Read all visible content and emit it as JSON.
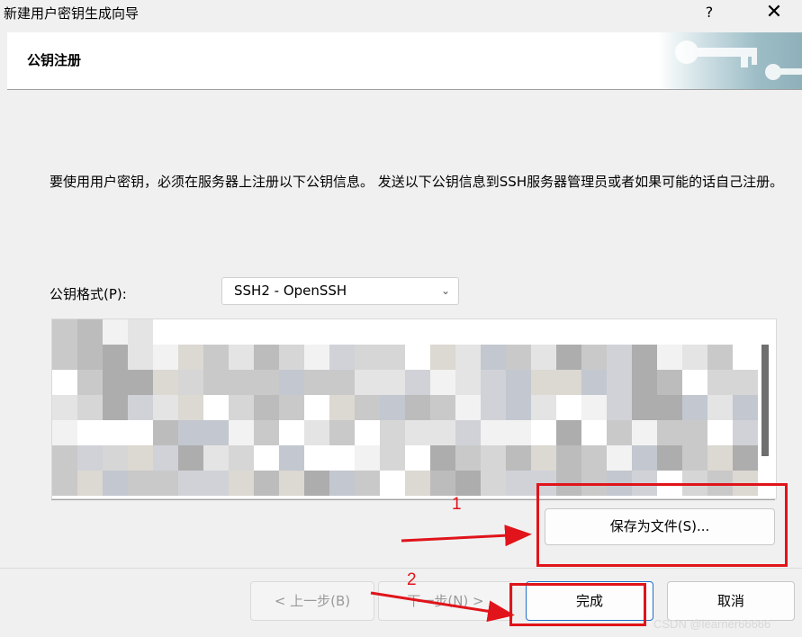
{
  "window": {
    "title": "新建用户密钥生成向导",
    "help_label": "?",
    "close_label": "✕"
  },
  "header": {
    "title": "公钥注册",
    "banner_icon": "key-icon"
  },
  "main": {
    "description": "要使用用户密钥，必须在服务器上注册以下公钥信息。 发送以下公钥信息到SSH服务器管理员或者如果可能的话自己注册。",
    "format_label": "公钥格式(P):",
    "format_value": "SSH2 - OpenSSH",
    "save_button": "保存为文件(S)..."
  },
  "footer": {
    "back_button": "< 上一步(B)",
    "next_button": "下一步(N) >",
    "finish_button": "完成",
    "cancel_button": "取消"
  },
  "annotations": {
    "marker_1": "1",
    "marker_2": "2"
  },
  "watermark": "CSDN @learner66666",
  "colors": {
    "annotation_red": "#e0141a",
    "primary_border": "#1f6fc8"
  }
}
